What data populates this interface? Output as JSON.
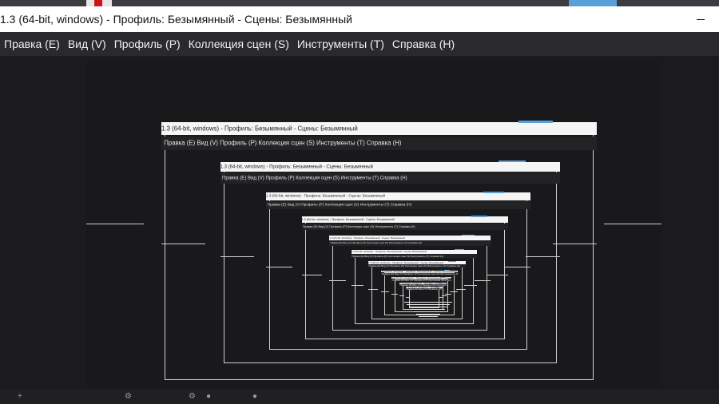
{
  "window": {
    "title": "1.3 (64-bit, windows) - Профиль: Безымянный - Сцены: Безымянный",
    "minimize_icon": "minimize-icon"
  },
  "menu": {
    "items": [
      {
        "label": "Правка (E)"
      },
      {
        "label": "Вид (V)"
      },
      {
        "label": "Профиль (P)"
      },
      {
        "label": "Коллекция сцен (S)"
      },
      {
        "label": "Инструменты (T)"
      },
      {
        "label": "Справка (H)"
      }
    ]
  },
  "preview": {
    "nested_title": "1.3 (64-bit, windows) - Профиль: Безымянный - Сцены: Безымянный",
    "nested_menu": "Правка (E)    Вид (V)    Профиль (P)    Коллекция сцен (S)    Инструменты (T)    Справка (H)"
  },
  "colors": {
    "background": "#1b1b1e",
    "menu_bar": "#2a2a2d",
    "title_bar": "#ffffff",
    "accent_blue": "#5aa0d8",
    "logo_red": "#d0121e"
  },
  "bottom_bar": {
    "icons": [
      "plus-icon",
      "gear-icon",
      "gear-icon",
      "settings-icon",
      "circle-icon"
    ]
  }
}
